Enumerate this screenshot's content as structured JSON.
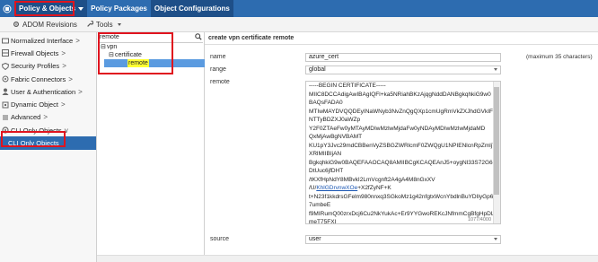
{
  "topnav": {
    "policy_objects": "Policy & Objects",
    "policy_packages": "Policy Packages",
    "object_configurations": "Object Configurations"
  },
  "toolbar": {
    "adom_revisions": "ADOM Revisions",
    "tools": "Tools"
  },
  "sidebar": {
    "items": [
      {
        "label": "Normalized Interface",
        "chevron": ">"
      },
      {
        "label": "Firewall Objects",
        "chevron": ">"
      },
      {
        "label": "Security Profiles",
        "chevron": ">"
      },
      {
        "label": "Fabric Connectors",
        "chevron": ">"
      },
      {
        "label": "User & Authentication",
        "chevron": ">"
      },
      {
        "label": "Dynamic Object",
        "chevron": ">"
      },
      {
        "label": "Advanced",
        "chevron": ">"
      },
      {
        "label": "CLI Only Objects",
        "chevron": "v"
      },
      {
        "label": "CLI Only Objects",
        "chevron": ""
      }
    ]
  },
  "tree": {
    "search_value": "remote",
    "nodes": [
      "vpn",
      "certificate",
      "remote"
    ]
  },
  "main": {
    "header": "create vpn certificate remote",
    "fields": {
      "name_label": "name",
      "name_value": "azure_cert",
      "name_hint": "(maximum 35 characters)",
      "range_label": "range",
      "range_value": "global",
      "remote_label": "remote",
      "source_label": "source",
      "source_value": "user"
    },
    "certificate_lines": [
      "-----BEGIN CERTIFICATE-----",
      "MIIC8DCCAdigAwIBAgIQFl+ka5NRiahBKzAjqgNddDANBgkqhkiG9w0",
      "BAQsFADA0",
      "MTIwMAYDVQQDEyINaWNyb3NvZnQgQXp1cmUgRmVkZXJhdGVkIF",
      "NTTyBDZXJ0aWZp",
      "Y2F0ZTAeFw0yMTAyMDIwMzlwMjdaFw0yNDAyMDIwMzlwMjdaMD",
      "QxMjAwBgNVBAMT",
      "KU1pY3Jvc29mdCBBenVyZSBGZWRlcmF0ZWQgU1NPIENlcnRpZmljY",
      "XRlMIIBIjAN",
      "BgkqhkiG9w0BAQEFAAOCAQ8AMIIBCgKCAQEAnJ5+oygNl33S72G6",
      "DtUuc6jfDHT",
      "/tKXfHpNdY8MBvkI2LmVcgnft2A4gA4M8nGxXV",
      "/U/",
      "+X2fZyNF+K",
      "t+N23f1kkdrsGFelm980nnxq3SGkoMz1g42nfgtxWcnYbdlnBuYDIlyGp6",
      "7umbeE",
      "f9MIRumQ00zrxDcj6Cu2NkYukAc+Er9YYGwoREKcJNfmmCgBfgHpDL",
      "meT75FXI"
    ],
    "line12_link": "KhlGDrvnwXOe",
    "char_counter": "1077/4000"
  }
}
